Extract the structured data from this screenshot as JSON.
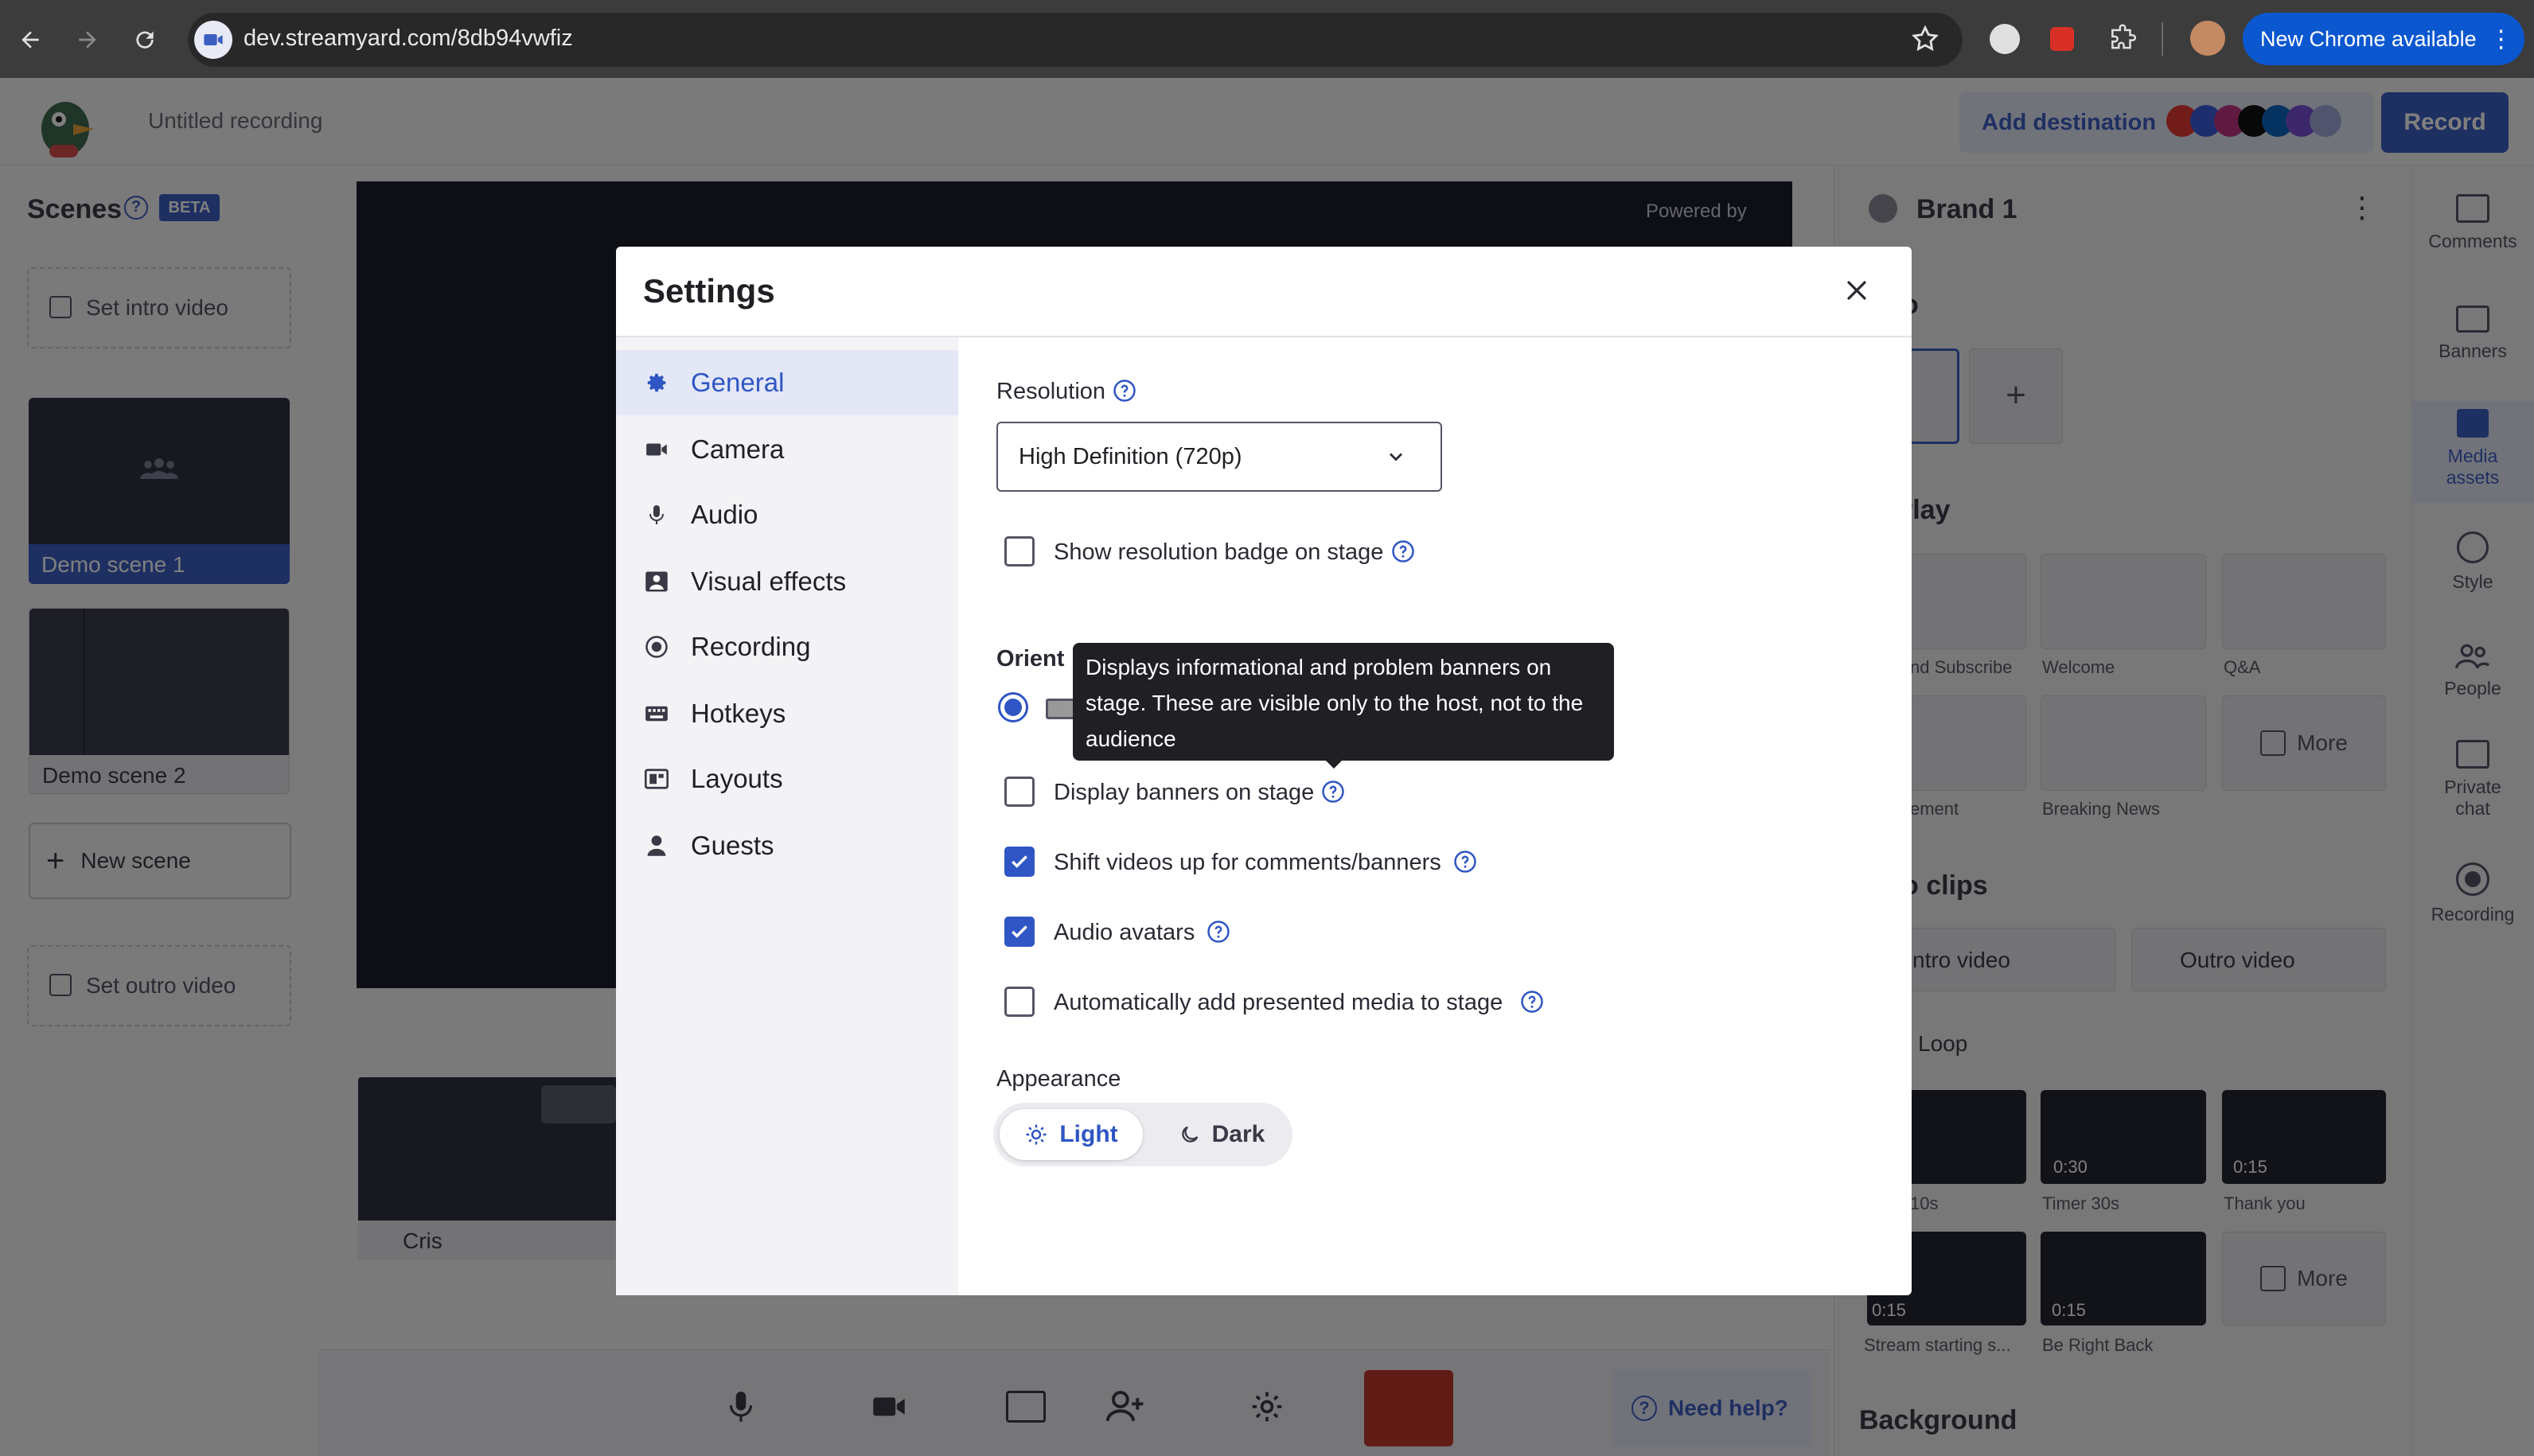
{
  "browser": {
    "url": "dev.streamyard.com/8db94vwfiz",
    "update_label": "New Chrome available"
  },
  "header": {
    "recording_title": "Untitled recording",
    "add_destination_label": "Add destination",
    "record_label": "Record"
  },
  "scenes": {
    "title": "Scenes",
    "beta_badge": "BETA",
    "intro_label": "Set intro video",
    "items": [
      {
        "label": "Demo scene 1"
      },
      {
        "label": "Demo scene 2"
      }
    ],
    "new_scene_label": "New scene",
    "outro_label": "Set outro video"
  },
  "stage": {
    "powered_by": "Powered by",
    "participant_name": "Cris",
    "need_help_label": "Need help?"
  },
  "right_panel": {
    "brand_label": "Brand 1",
    "overlay_items": [
      "nd Subscribe",
      "Welcome",
      "Q&A"
    ],
    "banner_items": [
      "ement",
      "Breaking News"
    ],
    "more_label": "More",
    "clips_title": "o clips",
    "intro_clip": "ntro video",
    "outro_clip": "Outro video",
    "loop_label": "Loop",
    "clip_items": [
      {
        "duration": "",
        "label": "10s"
      },
      {
        "duration": "0:30",
        "label": "Timer 30s"
      },
      {
        "duration": "0:15",
        "label": "Thank you"
      },
      {
        "duration": "0:15",
        "label": "Stream starting s..."
      },
      {
        "duration": "0:15",
        "label": "Be Right Back"
      }
    ],
    "logo_section": "o",
    "overlay_section": "rlay",
    "background_title": "Background"
  },
  "right_rail": {
    "items": [
      {
        "label": "Comments"
      },
      {
        "label": "Banners"
      },
      {
        "label": "Media assets"
      },
      {
        "label": "Style"
      },
      {
        "label": "People"
      },
      {
        "label": "Private chat"
      },
      {
        "label": "Recording"
      }
    ]
  },
  "settings_modal": {
    "title": "Settings",
    "nav": [
      {
        "label": "General",
        "icon": "gear-icon"
      },
      {
        "label": "Camera",
        "icon": "camera-icon"
      },
      {
        "label": "Audio",
        "icon": "microphone-icon"
      },
      {
        "label": "Visual effects",
        "icon": "visual-effects-icon"
      },
      {
        "label": "Recording",
        "icon": "record-icon"
      },
      {
        "label": "Hotkeys",
        "icon": "keyboard-icon"
      },
      {
        "label": "Layouts",
        "icon": "layouts-icon"
      },
      {
        "label": "Guests",
        "icon": "person-icon"
      }
    ],
    "resolution_label": "Resolution",
    "resolution_value": "High Definition (720p)",
    "orientation_label": "Orient",
    "options": [
      {
        "label": "Show resolution badge on stage",
        "checked": false
      },
      {
        "label": "Display banners on stage",
        "checked": false
      },
      {
        "label": "Shift videos up for comments/banners",
        "checked": true
      },
      {
        "label": "Audio avatars",
        "checked": true
      },
      {
        "label": "Automatically add presented media to stage",
        "checked": false
      }
    ],
    "tooltip": "Displays informational and problem banners on stage. These are visible only to the host, not to the audience",
    "appearance_label": "Appearance",
    "appearance_light": "Light",
    "appearance_dark": "Dark"
  },
  "colors": {
    "accent": "#2f56c4",
    "record_button": "#3d5fc2",
    "leave_button": "#c0392b",
    "chrome_update": "#0b57d0"
  }
}
